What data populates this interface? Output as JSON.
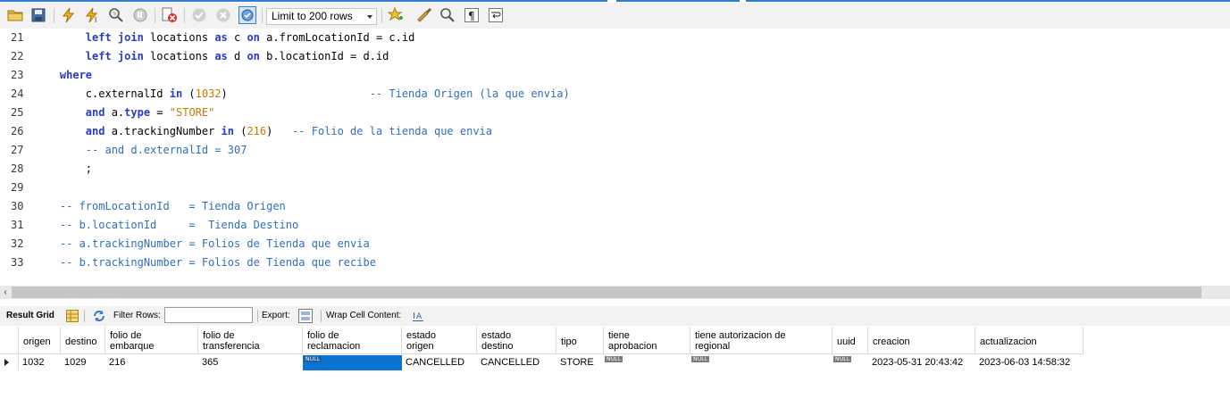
{
  "toolbar": {
    "limit_label": "Limit to 200 rows",
    "icons": [
      "open-folder-icon",
      "save-icon",
      "execute-icon",
      "execute-current-icon",
      "explain-icon",
      "stop-icon",
      "toggle-error-stop-icon",
      "commit-icon",
      "rollback-icon",
      "autocommit-icon",
      "bookmark-icon",
      "beautify-icon",
      "find-icon",
      "invisible-chars-icon",
      "wrap-icon"
    ]
  },
  "editor": {
    "lines": [
      {
        "n": "21",
        "indent": "        ",
        "tokens": [
          [
            "kw",
            "left join"
          ],
          [
            "id",
            " locations "
          ],
          [
            "kw",
            "as"
          ],
          [
            "id",
            " c "
          ],
          [
            "kw",
            "on"
          ],
          [
            "id",
            " a.fromLocationId = c.id"
          ]
        ]
      },
      {
        "n": "22",
        "indent": "        ",
        "tokens": [
          [
            "kw",
            "left join"
          ],
          [
            "id",
            " locations "
          ],
          [
            "kw",
            "as"
          ],
          [
            "id",
            " d "
          ],
          [
            "kw",
            "on"
          ],
          [
            "id",
            " b.locationId = d.id"
          ]
        ]
      },
      {
        "n": "23",
        "indent": "    ",
        "tokens": [
          [
            "kw",
            "where"
          ]
        ]
      },
      {
        "n": "24",
        "indent": "        ",
        "tokens": [
          [
            "id",
            "c.externalId "
          ],
          [
            "kw",
            "in"
          ],
          [
            "id",
            " ("
          ],
          [
            "num",
            "1032"
          ],
          [
            "id",
            ")                      "
          ],
          [
            "cm",
            "-- Tienda Origen (la que envia)"
          ]
        ]
      },
      {
        "n": "25",
        "indent": "        ",
        "tokens": [
          [
            "kw",
            "and"
          ],
          [
            "id",
            " a."
          ],
          [
            "kw",
            "type"
          ],
          [
            "id",
            " = "
          ],
          [
            "str",
            "\"STORE\""
          ]
        ]
      },
      {
        "n": "26",
        "indent": "        ",
        "tokens": [
          [
            "kw",
            "and"
          ],
          [
            "id",
            " a.trackingNumber "
          ],
          [
            "kw",
            "in"
          ],
          [
            "id",
            " ("
          ],
          [
            "num",
            "216"
          ],
          [
            "id",
            ")   "
          ],
          [
            "cm",
            "-- Folio de la tienda que envia"
          ]
        ]
      },
      {
        "n": "27",
        "indent": "        ",
        "tokens": [
          [
            "cm",
            "-- and d.externalId = 307"
          ]
        ]
      },
      {
        "n": "28",
        "indent": "        ",
        "tokens": [
          [
            "id",
            ";"
          ]
        ]
      },
      {
        "n": "29",
        "indent": "",
        "tokens": []
      },
      {
        "n": "30",
        "indent": "    ",
        "tokens": [
          [
            "cm",
            "-- fromLocationId   = Tienda Origen"
          ]
        ]
      },
      {
        "n": "31",
        "indent": "    ",
        "tokens": [
          [
            "cm",
            "-- b.locationId     =  Tienda Destino"
          ]
        ]
      },
      {
        "n": "32",
        "indent": "    ",
        "tokens": [
          [
            "cm",
            "-- a.trackingNumber = Folios de Tienda que envia"
          ]
        ]
      },
      {
        "n": "33",
        "indent": "    ",
        "tokens": [
          [
            "cm",
            "-- b.trackingNumber = Folios de Tienda que recibe"
          ]
        ]
      }
    ]
  },
  "result_toolbar": {
    "result_grid_label": "Result Grid",
    "filter_rows_label": "Filter Rows:",
    "filter_value": "",
    "export_label": "Export:",
    "wrap_label": "Wrap Cell Content:"
  },
  "grid": {
    "columns": [
      {
        "key": "origen",
        "label": "origen"
      },
      {
        "key": "destino",
        "label": "destino"
      },
      {
        "key": "folio_embarque",
        "label": "folio de\nembarque"
      },
      {
        "key": "folio_transferencia",
        "label": "folio de\ntransferencia"
      },
      {
        "key": "folio_reclamacion",
        "label": "folio de\nreclamacion"
      },
      {
        "key": "estado_origen",
        "label": "estado\norigen"
      },
      {
        "key": "estado_destino",
        "label": "estado\ndestino"
      },
      {
        "key": "tipo",
        "label": "tipo"
      },
      {
        "key": "tiene_aprobacion",
        "label": "tiene\naprobacion"
      },
      {
        "key": "tiene_autorizacion",
        "label": "tiene autorizacion de\nregional"
      },
      {
        "key": "uuid",
        "label": "uuid"
      },
      {
        "key": "creacion",
        "label": "creacion"
      },
      {
        "key": "actualizacion",
        "label": "actualizacion"
      }
    ],
    "rows": [
      [
        "1032",
        "1029",
        "216",
        "365",
        "NULL",
        "CANCELLED",
        "CANCELLED",
        "STORE",
        "NULL",
        "NULL",
        "NULL",
        "2023-05-31 20:43:42",
        "2023-06-03 14:58:32"
      ]
    ],
    "null_text": "NULL"
  }
}
